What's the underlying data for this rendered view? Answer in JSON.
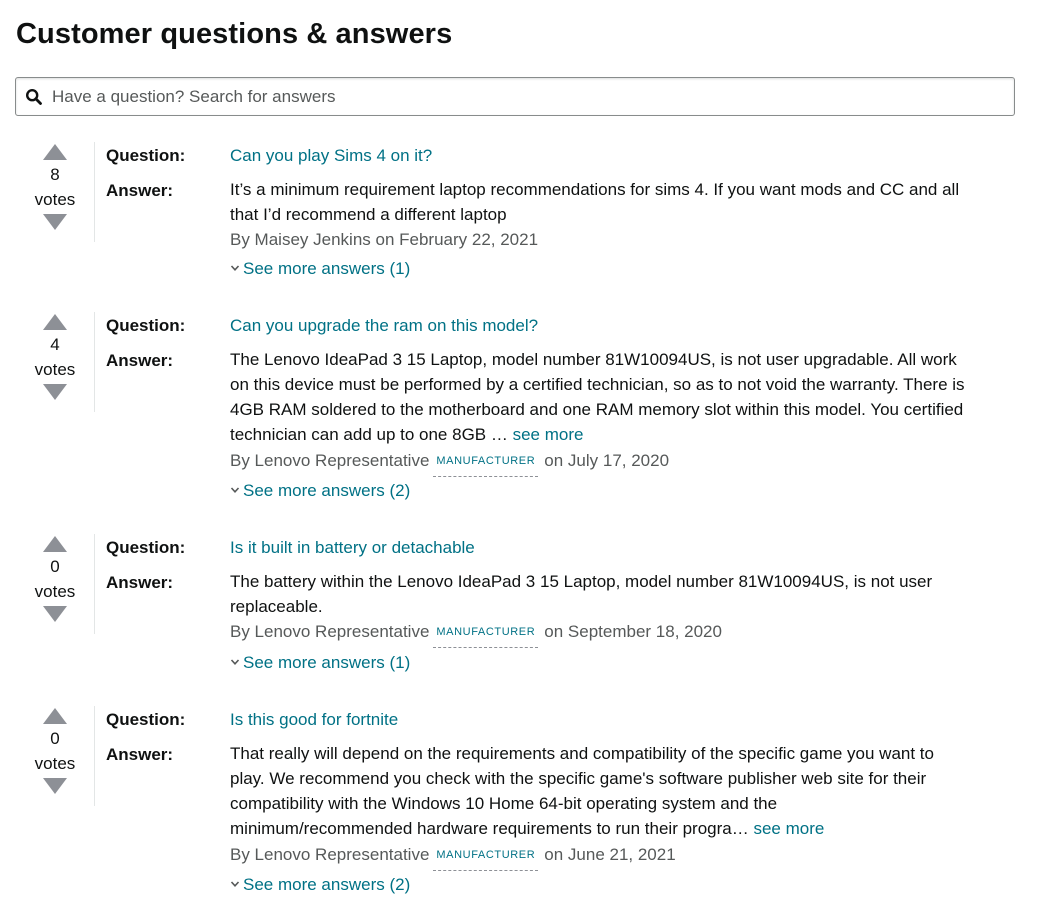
{
  "page": {
    "title": "Customer questions & answers"
  },
  "search": {
    "placeholder": "Have a question? Search for answers",
    "value": ""
  },
  "labels": {
    "question": "Question:",
    "answer": "Answer:",
    "votes": "votes",
    "see_more": "see more"
  },
  "colors": {
    "link": "#007185",
    "text": "#0f1111",
    "muted": "#565959",
    "vote_arrow": "#8d9096"
  },
  "qa": [
    {
      "votes": "8",
      "question": "Can you play Sims 4 on it?",
      "answer_lines": [
        "It’s a minimum requirement laptop recommendations for sims 4. If you want mods and CC and all",
        "that I’d recommend a different laptop"
      ],
      "truncated": false,
      "by_prefix": "By Maisey Jenkins on February 22, 2021",
      "badge": "",
      "date": "",
      "more_answers": "See more answers (1)"
    },
    {
      "votes": "4",
      "question": "Can you upgrade the ram on this model?",
      "answer_lines": [
        "The Lenovo IdeaPad 3 15 Laptop, model number 81W10094US, is not user upgradable. All work",
        "on this device must be performed by a certified technician, so as to not void the warranty. There is",
        "4GB RAM soldered to the motherboard and one RAM memory slot within this model. You certified",
        "technician can add up to one 8GB …"
      ],
      "truncated": true,
      "by_prefix": "By Lenovo Representative",
      "badge": "MANUFACTURER",
      "date": "on July 17, 2020",
      "more_answers": "See more answers (2)"
    },
    {
      "votes": "0",
      "question": "Is it built in battery or detachable",
      "answer_lines": [
        "The battery within the Lenovo IdeaPad 3 15 Laptop, model number 81W10094US, is not user",
        "replaceable."
      ],
      "truncated": false,
      "by_prefix": "By Lenovo Representative",
      "badge": "MANUFACTURER",
      "date": "on September 18, 2020",
      "more_answers": "See more answers (1)"
    },
    {
      "votes": "0",
      "question": "Is this good for fortnite",
      "answer_lines": [
        "That really will depend on the requirements and compatibility of the specific game you want to",
        "play. We recommend you check with the specific game's software publisher web site for their",
        "compatibility with the Windows 10 Home 64-bit operating system and the",
        "minimum/recommended hardware requirements to run their progra…"
      ],
      "truncated": true,
      "by_prefix": "By Lenovo Representative",
      "badge": "MANUFACTURER",
      "date": "on June 21, 2021",
      "more_answers": "See more answers (2)"
    }
  ]
}
